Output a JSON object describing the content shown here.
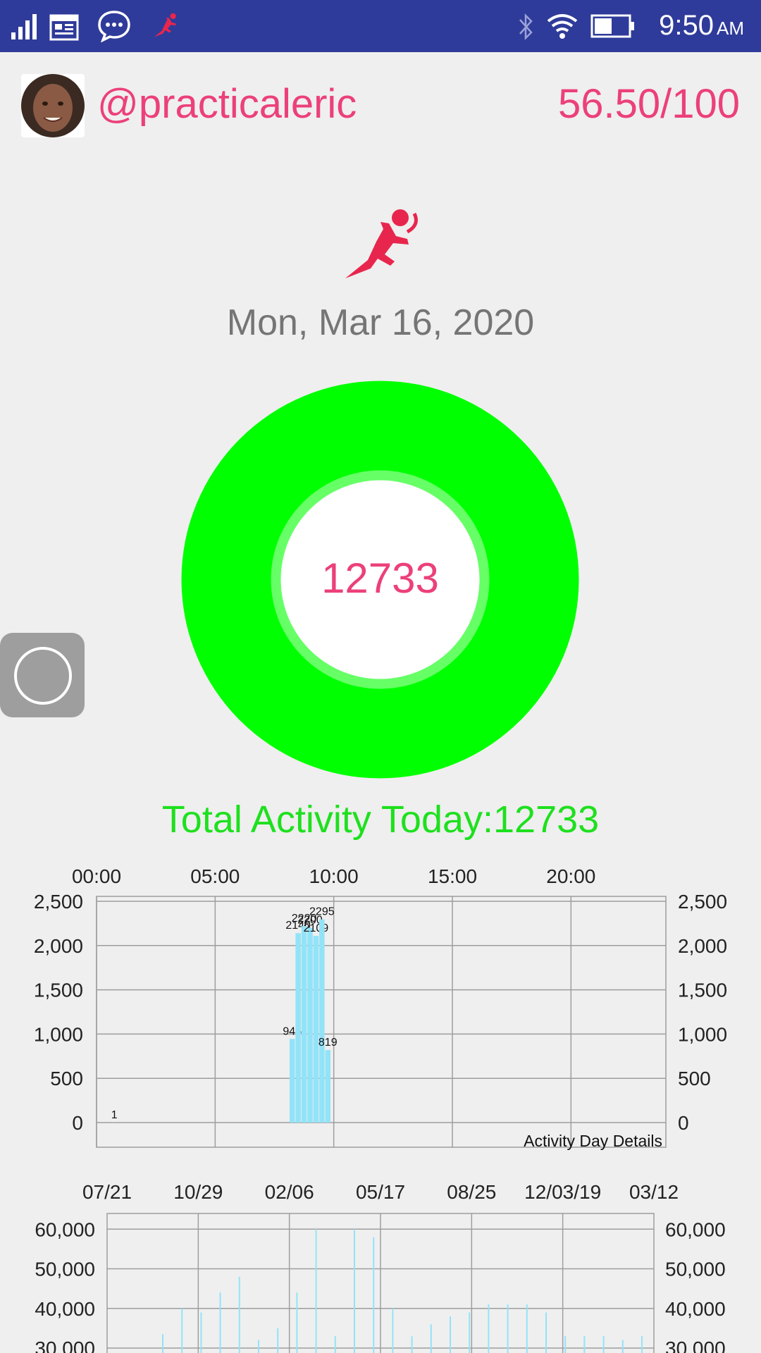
{
  "status_bar": {
    "time": "9:50",
    "ampm": "AM",
    "icons": [
      "signal-icon",
      "calendar-icon",
      "chat-icon",
      "runner-icon",
      "bluetooth-icon",
      "wifi-icon",
      "battery-icon"
    ],
    "background": "#2f3b9a"
  },
  "profile": {
    "username": "@practicaleric",
    "score": "56.50/100"
  },
  "date": "Mon, Mar 16, 2020",
  "ring": {
    "value": "12733",
    "outer_color": "#00ff00",
    "inner_ring_color": "#66ff66",
    "value_color": "#ec407a"
  },
  "total_activity": "Total Activity Today:12733",
  "colors": {
    "accent": "#ec407a",
    "green": "#1ee01e",
    "bar": "#93e3f8",
    "grid": "#9e9e9e"
  },
  "chart_data": [
    {
      "type": "bar",
      "description": "Activity Day Details",
      "x_axis_labels": [
        "00:00",
        "05:00",
        "10:00",
        "15:00",
        "20:00"
      ],
      "xlim_hours": [
        0,
        24
      ],
      "ylim": [
        0,
        2500
      ],
      "y_ticks": [
        "0",
        "500",
        "1,000",
        "1,500",
        "2,000",
        "2,500"
      ],
      "y_tick_values": [
        0,
        500,
        1000,
        1500,
        2000,
        2500
      ],
      "series": [
        {
          "points": [
            {
              "hour": 0.75,
              "value": 1,
              "label": "1"
            },
            {
              "hour": 8.25,
              "value": 945,
              "label": "945"
            },
            {
              "hour": 8.5,
              "value": 2140,
              "label": "2140"
            },
            {
              "hour": 8.75,
              "value": 2220,
              "label": "2220"
            },
            {
              "hour": 9.0,
              "value": 2200,
              "label": "2200"
            },
            {
              "hour": 9.25,
              "value": 2109,
              "label": "2109"
            },
            {
              "hour": 9.5,
              "value": 2295,
              "label": "2295"
            },
            {
              "hour": 9.75,
              "value": 819,
              "label": "819"
            }
          ]
        }
      ],
      "grid": true,
      "corner_label": "Activity Day Details"
    },
    {
      "type": "bar",
      "x_axis_labels": [
        "07/21",
        "10/29",
        "02/06",
        "05/17",
        "08/25",
        "12/03/19",
        "03/12"
      ],
      "y_ticks": [
        "30,000",
        "40,000",
        "50,000",
        "60,000"
      ],
      "y_tick_values": [
        30000,
        40000,
        50000,
        60000
      ],
      "ylim_visible": [
        30000,
        62000
      ],
      "grid": true,
      "series": [
        {
          "values": [
            33500,
            40000,
            39000,
            44000,
            48000,
            32000,
            35000,
            44000,
            60000,
            33000,
            60000,
            58000,
            40000,
            33000,
            36000,
            38000,
            39000,
            41000,
            41000,
            41000,
            39000,
            33000,
            33000,
            33000,
            32000,
            33000
          ]
        }
      ]
    }
  ]
}
